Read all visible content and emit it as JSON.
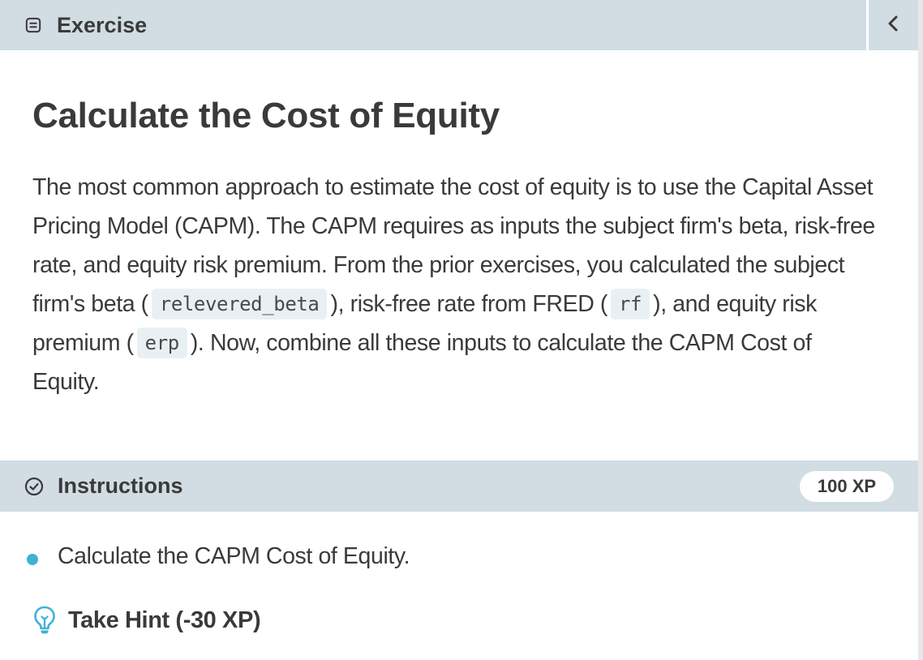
{
  "header": {
    "tab_label": "Exercise",
    "tab_icon": "document-icon",
    "collapse_icon": "chevron-left-icon"
  },
  "exercise": {
    "title": "Calculate the Cost of Equity",
    "description": {
      "text_1": "The most common approach to estimate the cost of equity is to use the Capital Asset Pricing Model (CAPM). The CAPM requires as inputs the subject firm's beta, risk-free rate, and equity risk premium. From the prior exercises, you calculated the subject firm's beta (",
      "code_1": "relevered_beta",
      "text_2": "), risk-free rate from FRED (",
      "code_2": "rf",
      "text_3": "), and equity risk premium (",
      "code_3": "erp",
      "text_4": "). Now, combine all these inputs to calculate the CAPM Cost of Equity."
    }
  },
  "instructions": {
    "label": "Instructions",
    "icon": "check-circle-icon",
    "xp_badge": "100 XP",
    "items": [
      {
        "text": "Calculate the CAPM Cost of Equity."
      }
    ],
    "hint": {
      "label": "Take Hint (-30 XP)",
      "icon": "lightbulb-icon"
    }
  },
  "colors": {
    "header_bg": "#d1dce3",
    "text": "#3a3a3a",
    "code_bg": "#e9f0f3",
    "accent_blue": "#3fb2d4"
  }
}
